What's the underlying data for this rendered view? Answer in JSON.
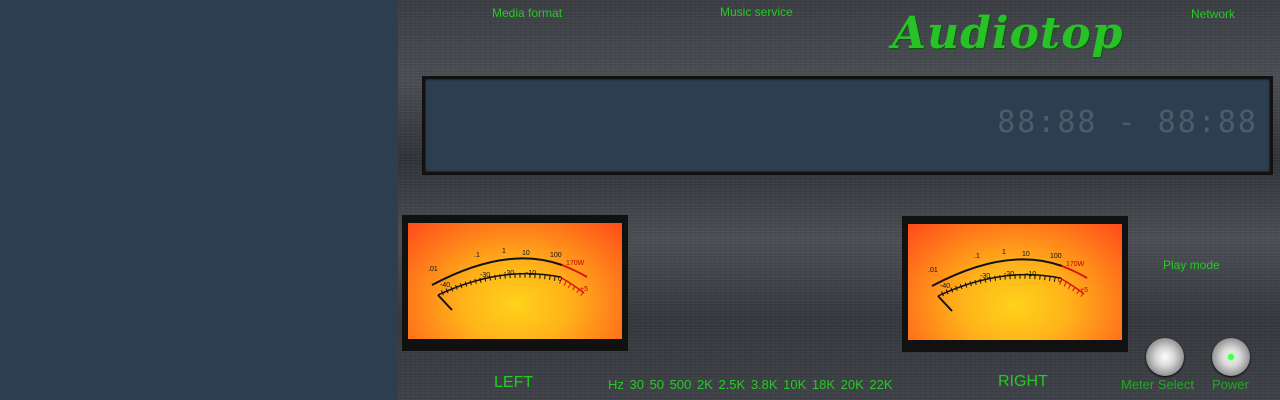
{
  "top": {
    "media_format": "Media format",
    "music_service": "Music service",
    "network": "Network",
    "logo": "Audiotop"
  },
  "display": {
    "time": "88:88 - 88:88"
  },
  "meters": {
    "left_label": "LEFT",
    "right_label": "RIGHT",
    "scale_top": [
      ".01",
      ".1",
      "1",
      "1",
      "10",
      "100",
      "170W"
    ],
    "scale_db": [
      "-40",
      "-30",
      "-20",
      "-10",
      "0",
      "+5"
    ]
  },
  "frequency": "Hz   30 50   500 2K 2.5K   3.8K 10K 18K   20K   22K",
  "controls": {
    "play_mode": "Play mode",
    "meter_select": "Meter Select",
    "power": "Power"
  },
  "colors": {
    "accent": "#22cc22",
    "display_bg": "#2c3e50",
    "meter_face": "#ffb31a"
  }
}
